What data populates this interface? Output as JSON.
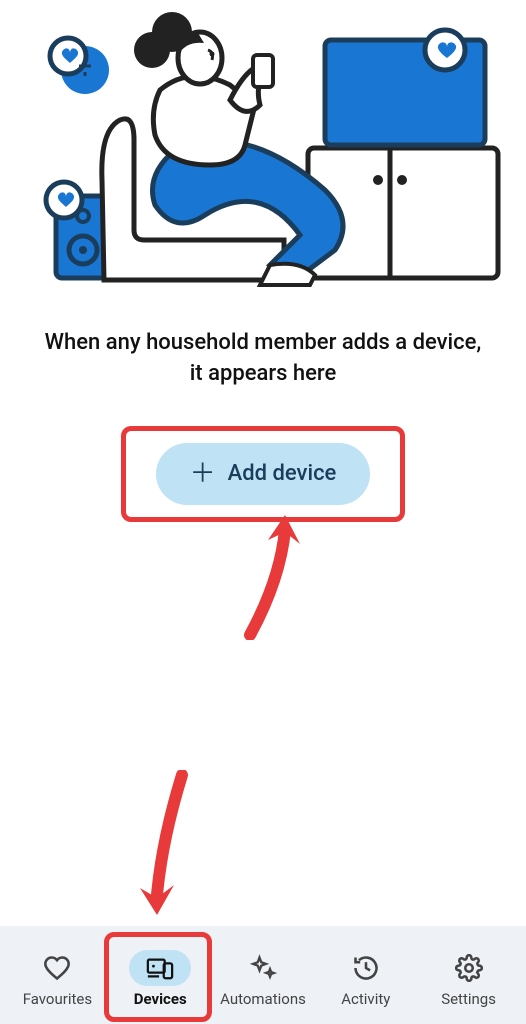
{
  "main": {
    "empty_message": "When any household member adds a device, it appears here",
    "add_button_label": "Add device"
  },
  "nav": {
    "items": [
      {
        "label": "Favourites",
        "icon": "heart-icon",
        "active": false
      },
      {
        "label": "Devices",
        "icon": "devices-icon",
        "active": true
      },
      {
        "label": "Automations",
        "icon": "sparkle-icon",
        "active": false
      },
      {
        "label": "Activity",
        "icon": "clock-icon",
        "active": false
      },
      {
        "label": "Settings",
        "icon": "gear-icon",
        "active": false
      }
    ]
  },
  "annotations": {
    "highlight_add_button": true,
    "highlight_devices_tab": true,
    "arrows": 2
  }
}
